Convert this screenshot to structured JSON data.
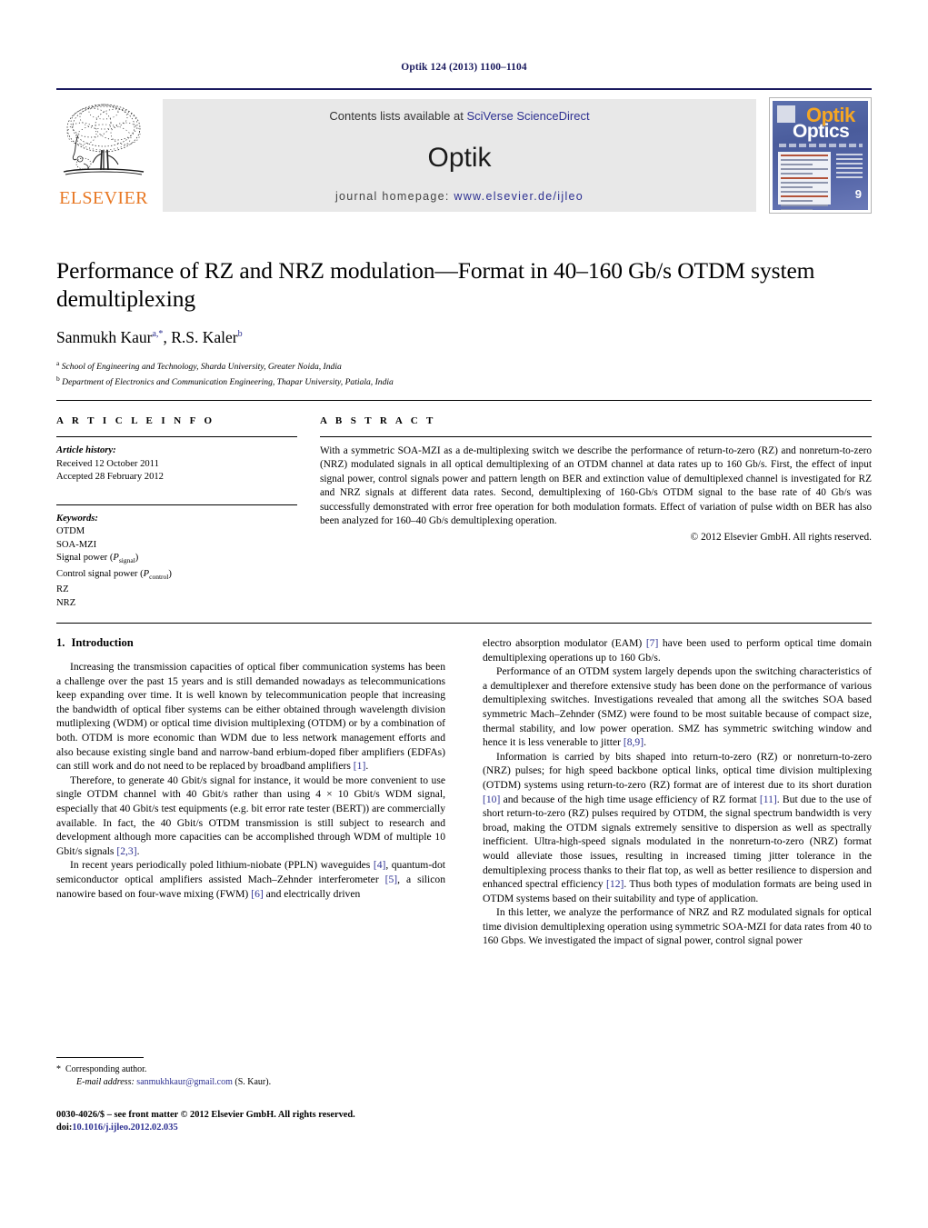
{
  "running_head": "Optik 124 (2013) 1100–1104",
  "masthead": {
    "publisher_logo_label": "ELSEVIER",
    "contents_prefix": "Contents lists available at ",
    "contents_link": "SciVerse ScienceDirect",
    "journal_name": "Optik",
    "homepage_prefix": "journal homepage: ",
    "homepage_link": "www.elsevier.de/ijleo",
    "cover": {
      "title_primary": "Optik",
      "title_secondary": "Optics",
      "issue_number": "9"
    }
  },
  "article": {
    "title": "Performance of RZ and NRZ modulation—Format in 40–160 Gb/s OTDM system demultiplexing",
    "authors": [
      {
        "name": "Sanmukh Kaur",
        "marks": "a,*"
      },
      {
        "name": "R.S. Kaler",
        "marks": "b"
      }
    ],
    "affiliations": [
      {
        "mark": "a",
        "text": "School of Engineering and Technology, Sharda University, Greater Noida, India"
      },
      {
        "mark": "b",
        "text": "Department of Electronics and Communication Engineering, Thapar University, Patiala, India"
      }
    ]
  },
  "article_info": {
    "heading": "A R T I C L E    I N F O",
    "history_label": "Article history:",
    "history": [
      "Received 12 October 2011",
      "Accepted 28 February 2012"
    ],
    "keywords_label": "Keywords:",
    "keywords": [
      "OTDM",
      "SOA-MZI",
      "Signal power (Psignal)",
      "Control signal power (Pcontrol)",
      "RZ",
      "NRZ"
    ]
  },
  "abstract": {
    "heading": "A B S T R A C T",
    "text": "With a symmetric SOA-MZI as a de-multiplexing switch we describe the performance of return-to-zero (RZ) and nonreturn-to-zero (NRZ) modulated signals in all optical demultiplexing of an OTDM channel at data rates up to 160 Gb/s. First, the effect of input signal power, control signals power and pattern length on BER and extinction value of demultiplexed channel is investigated for RZ and NRZ signals at different data rates. Second, demultiplexing of 160-Gb/s OTDM signal to the base rate of 40 Gb/s was successfully demonstrated with error free operation for both modulation formats. Effect of variation of pulse width on BER has also been analyzed for 160–40 Gb/s demultiplexing operation.",
    "copyright": "© 2012 Elsevier GmbH. All rights reserved."
  },
  "body": {
    "section_number": "1.",
    "section_title": "Introduction",
    "left_paragraphs": [
      "Increasing the transmission capacities of optical fiber communication systems has been a challenge over the past 15 years and is still demanded nowadays as telecommunications keep expanding over time. It is well known by telecommunication people that increasing the bandwidth of optical fiber systems can be either obtained through wavelength division mutliplexing (WDM) or optical time division multiplexing (OTDM) or by a combination of both. OTDM is more economic than WDM due to less network management efforts and also because existing single band and narrow-band erbium-doped fiber amplifiers (EDFAs) can still work and do not need to be replaced by broadband amplifiers [1].",
      "Therefore, to generate 40 Gbit/s signal for instance, it would be more convenient to use single OTDM channel with 40 Gbit/s rather than using 4 × 10 Gbit/s WDM signal, especially that 40 Gbit/s test equipments (e.g. bit error rate tester (BERT)) are commercially available. In fact, the 40 Gbit/s OTDM transmission is still subject to research and development although more capacities can be accomplished through WDM of multiple 10 Gbit/s signals [2,3].",
      "In recent years periodically poled lithium-niobate (PPLN) waveguides [4], quantum-dot semiconductor optical amplifiers assisted Mach–Zehnder interferometer [5], a silicon nanowire based on four-wave mixing (FWM) [6] and electrically driven"
    ],
    "right_paragraphs": [
      "electro absorption modulator (EAM) [7] have been used to perform optical time domain demultiplexing operations up to 160 Gb/s.",
      "Performance of an OTDM system largely depends upon the switching characteristics of a demultiplexer and therefore extensive study has been done on the performance of various demultiplexing switches. Investigations revealed that among all the switches SOA based symmetric Mach–Zehnder (SMZ) were found to be most suitable because of compact size, thermal stability, and low power operation. SMZ has symmetric switching window and hence it is less venerable to jitter [8,9].",
      "Information is carried by bits shaped into return-to-zero (RZ) or nonreturn-to-zero (NRZ) pulses; for high speed backbone optical links, optical time division multiplexing (OTDM) systems using return-to-zero (RZ) format are of interest due to its short duration [10] and because of the high time usage efficiency of RZ format [11]. But due to the use of short return-to-zero (RZ) pulses required by OTDM, the signal spectrum bandwidth is very broad, making the OTDM signals extremely sensitive to dispersion as well as spectrally inefficient. Ultra-high-speed signals modulated in the nonreturn-to-zero (NRZ) format would alleviate those issues, resulting in increased timing jitter tolerance in the demultiplexing process thanks to their flat top, as well as better resilience to dispersion and enhanced spectral efficiency [12]. Thus both types of modulation formats are being used in OTDM systems based on their suitability and type of application.",
      "In this letter, we analyze the performance of NRZ and RZ modulated signals for optical time division demultiplexing operation using symmetric SOA-MZI for data rates from 40 to 160 Gbps. We investigated the impact of signal power, control signal power"
    ]
  },
  "footer": {
    "corresponding_marker": "*",
    "corresponding_text": "Corresponding author.",
    "email_label": "E-mail address:",
    "email": "sanmukhkaur@gmail.com",
    "email_suffix": "(S. Kaur).",
    "issn_line": "0030-4026/$ – see front matter © 2012 Elsevier GmbH. All rights reserved.",
    "doi_label": "doi:",
    "doi_value": "10.1016/j.ijleo.2012.02.035"
  },
  "colors": {
    "link": "#2e3192",
    "elsevier_orange": "#e87722",
    "running_head": "#1a1a5e"
  }
}
